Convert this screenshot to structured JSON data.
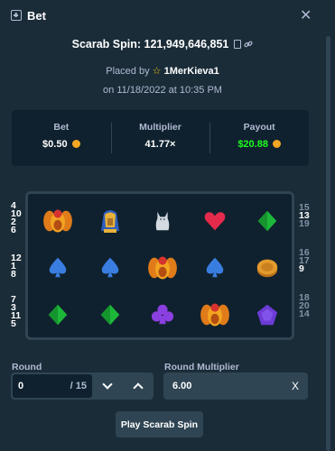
{
  "header": {
    "title": "Bet",
    "icons": [
      "bet-icon",
      "close-icon"
    ]
  },
  "game": {
    "title": "Scarab Spin: 121,949,646,851",
    "placed_by_prefix": "Placed by",
    "username": "1MerKieva1",
    "date": "on 11/18/2022 at 10:35 PM"
  },
  "stats": {
    "bet_label": "Bet",
    "bet_value": "$0.50",
    "multiplier_label": "Multiplier",
    "multiplier_value": "41.77×",
    "payout_label": "Payout",
    "payout_value": "$20.88"
  },
  "paylines": {
    "left": [
      [
        "4",
        "10",
        "2",
        "6"
      ],
      [
        "12",
        "1",
        "8"
      ],
      [
        "7",
        "3",
        "11",
        "5"
      ]
    ],
    "right": [
      [
        "15",
        "13",
        "19"
      ],
      [
        "16",
        "17",
        "9"
      ],
      [
        "18",
        "20",
        "14"
      ]
    ]
  },
  "board": {
    "rows": [
      [
        "scarab",
        "pharaoh",
        "cat-statue",
        "heart",
        "green-gem"
      ],
      [
        "spade",
        "spade",
        "scarab",
        "spade",
        "coin"
      ],
      [
        "green-gem",
        "green-gem",
        "club",
        "scarab",
        "purple-gem"
      ]
    ]
  },
  "round": {
    "label": "Round",
    "value": "0",
    "total": "/ 15"
  },
  "round_multiplier": {
    "label": "Round Multiplier",
    "value": "6.00",
    "clear": "X"
  },
  "play_button": "Play Scarab Spin",
  "colors": {
    "bg": "#1a2c38",
    "panel": "#0f212e",
    "field": "#2f4553",
    "payout": "#1fff20",
    "muted": "#b1bad3"
  }
}
